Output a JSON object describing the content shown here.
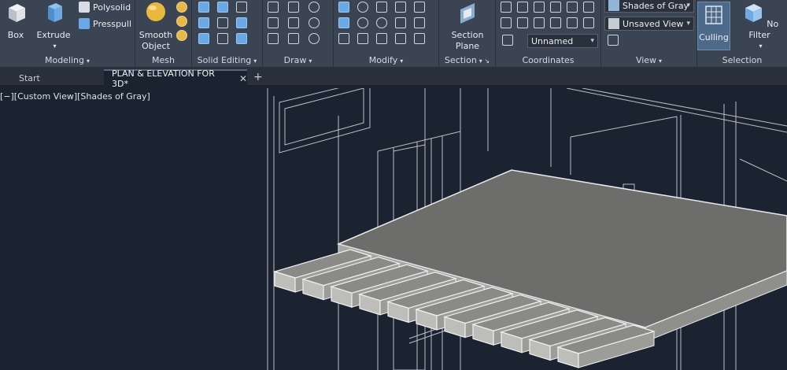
{
  "ribbon": {
    "modeling": {
      "title": "Modeling",
      "box_label": "Box",
      "extrude_label": "Extrude",
      "polysolid_label": "Polysolid",
      "presspull_label": "Presspull"
    },
    "mesh": {
      "title": "Mesh",
      "smooth_label_1": "Smooth",
      "smooth_label_2": "Object"
    },
    "solid_editing": {
      "title": "Solid Editing"
    },
    "draw": {
      "title": "Draw"
    },
    "modify": {
      "title": "Modify"
    },
    "section": {
      "title": "Section",
      "plane_label_1": "Section",
      "plane_label_2": "Plane"
    },
    "coordinates": {
      "title": "Coordinates",
      "ucs_combo_value": "Unnamed"
    },
    "view": {
      "title": "View",
      "visual_style_value": "Shades of Gray",
      "named_view_value": "Unsaved View"
    },
    "selection": {
      "title": "Selection",
      "culling_label": "Culling",
      "filter_label": "No Filter"
    }
  },
  "tabs": [
    {
      "label": "Start"
    },
    {
      "label": "PLAN & ELEVATION FOR 3D*",
      "close": "✕"
    }
  ],
  "add_tab": "+",
  "viewport": {
    "label": "[−][Custom View][Shades of Gray]"
  },
  "colors": {
    "ribbon_bg": "#3b4453",
    "viewport_bg": "#1b2230",
    "slab_top": "#6d6e6b",
    "slab_side": "#a7a8a4",
    "wire": "#d8dce2"
  }
}
